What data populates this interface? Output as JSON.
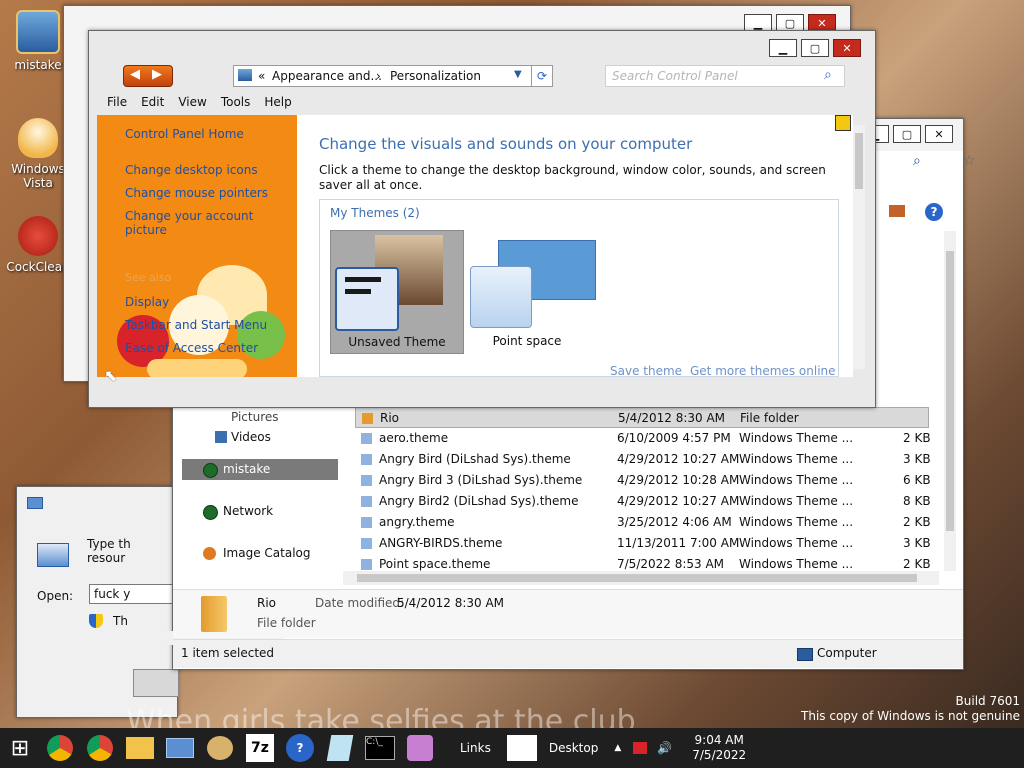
{
  "desktop": {
    "icons": [
      {
        "label": "mistake"
      },
      {
        "label": "Windows Vista"
      },
      {
        "label": "CockClean"
      }
    ],
    "watermark": {
      "build": "Build 7601",
      "genuine": "This copy of Windows is not genuine"
    },
    "wallpaper_caption": "When girls take selfies at the club"
  },
  "run_dialog": {
    "description": "Type th resour",
    "open_label": "Open:",
    "open_value": "fuck y",
    "admin_note": "Th"
  },
  "explorer": {
    "nav": [
      {
        "label": "Pictures"
      },
      {
        "label": "Videos"
      },
      {
        "label": "mistake"
      },
      {
        "label": "Network"
      },
      {
        "label": "Image Catalog"
      }
    ],
    "files": [
      {
        "name": "Rio",
        "date": "5/4/2012 8:30 AM",
        "type": "File folder",
        "size": ""
      },
      {
        "name": "aero.theme",
        "date": "6/10/2009 4:57 PM",
        "type": "Windows Theme ...",
        "size": "2 KB"
      },
      {
        "name": "Angry Bird (DiLshad Sys).theme",
        "date": "4/29/2012 10:27 AM",
        "type": "Windows Theme ...",
        "size": "3 KB"
      },
      {
        "name": "Angry Bird 3 (DiLshad Sys).theme",
        "date": "4/29/2012 10:28 AM",
        "type": "Windows Theme ...",
        "size": "6 KB"
      },
      {
        "name": "Angry Bird2 (DiLshad Sys).theme",
        "date": "4/29/2012 10:27 AM",
        "type": "Windows Theme ...",
        "size": "8 KB"
      },
      {
        "name": "angry.theme",
        "date": "3/25/2012 4:06 AM",
        "type": "Windows Theme ...",
        "size": "2 KB"
      },
      {
        "name": "ANGRY-BIRDS.theme",
        "date": "11/13/2011 7:00 AM",
        "type": "Windows Theme ...",
        "size": "3 KB"
      },
      {
        "name": "Point space.theme",
        "date": "7/5/2022 8:53 AM",
        "type": "Windows Theme ...",
        "size": "2 KB"
      }
    ],
    "details": {
      "name": "Rio",
      "date_label": "Date modified:",
      "date_value": "5/4/2012 8:30 AM",
      "type": "File folder"
    },
    "status": "1 item selected",
    "status_location": "Computer"
  },
  "personalization": {
    "breadcrumb_prefix": "«",
    "breadcrumb_1": "Appearance and...",
    "breadcrumb_sep": "›",
    "breadcrumb_2": "Personalization",
    "search_placeholder": "Search Control Panel",
    "menu": [
      "File",
      "Edit",
      "View",
      "Tools",
      "Help"
    ],
    "sidebar_links": [
      "Control Panel Home",
      "Change desktop icons",
      "Change mouse pointers",
      "Change your account picture"
    ],
    "see_also_heading": "See also",
    "see_also_links": [
      "Display",
      "Taskbar and Start Menu",
      "Ease of Access Center"
    ],
    "heading": "Change the visuals and sounds on your computer",
    "description": "Click a theme to change the desktop background, window color, sounds, and screen saver all at once.",
    "group_title": "My Themes (2)",
    "themes": [
      {
        "label": "Unsaved Theme"
      },
      {
        "label": "Point space"
      }
    ],
    "save_theme": "Save theme",
    "get_more": "Get more themes online"
  },
  "taskbar": {
    "links_label": "Links",
    "desktop_label": "Desktop",
    "time": "9:04 AM",
    "date": "7/5/2022",
    "seven_zip": "7z"
  },
  "colors": {
    "taskbar": "#1f1f1f",
    "sidebar_orange": "#f28a14",
    "link_blue": "#1f4fa3",
    "heading_blue": "#3c6fb0",
    "selection_gray": "#a9a9a9"
  }
}
